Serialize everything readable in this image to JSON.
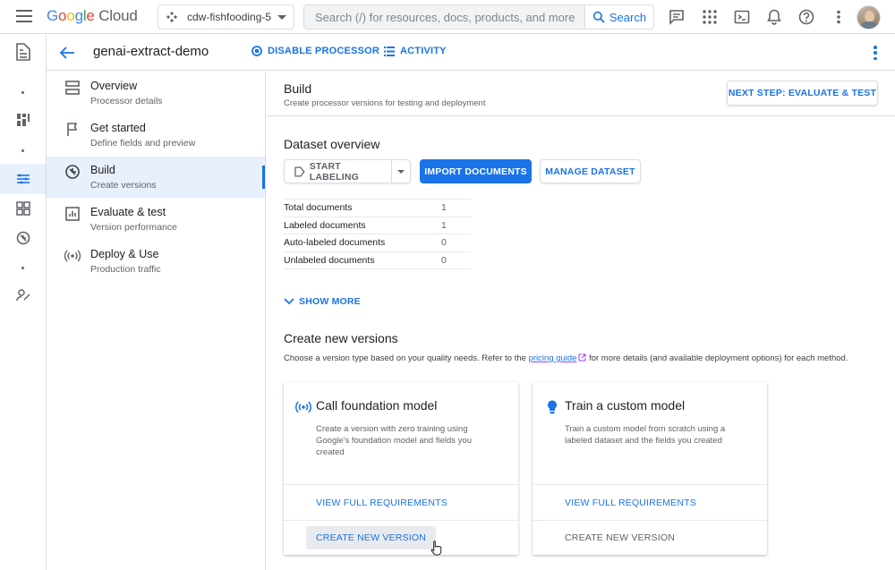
{
  "topbar": {
    "logo_google": [
      "G",
      "o",
      "o",
      "g",
      "l",
      "e"
    ],
    "logo_cloud": "Cloud",
    "project": "cdw-fishfooding-5",
    "search_placeholder": "Search (/) for resources, docs, products, and more",
    "search_button": "Search",
    "icons": [
      "hamburger-icon",
      "project-icon",
      "search-icon",
      "feedback-icon",
      "apps-icon",
      "cloud-shell-icon",
      "notifications-icon",
      "help-icon",
      "more-vert-icon",
      "avatar"
    ]
  },
  "header": {
    "title": "genai-extract-demo",
    "disable_label": "DISABLE PROCESSOR",
    "activity_label": "ACTIVITY"
  },
  "nav": {
    "items": [
      {
        "label": "Overview",
        "sub": "Processor details",
        "icon": "overview-icon"
      },
      {
        "label": "Get started",
        "sub": "Define fields and preview",
        "icon": "flag-icon"
      },
      {
        "label": "Build",
        "sub": "Create versions",
        "icon": "build-icon",
        "active": true
      },
      {
        "label": "Evaluate & test",
        "sub": "Version performance",
        "icon": "chart-icon"
      },
      {
        "label": "Deploy & Use",
        "sub": "Production traffic",
        "icon": "broadcast-icon"
      }
    ]
  },
  "build": {
    "title": "Build",
    "subtitle": "Create processor versions for testing and deployment",
    "next_step": "NEXT STEP: EVALUATE & TEST"
  },
  "dataset": {
    "title": "Dataset overview",
    "start_labeling": "START LABELING",
    "import_documents": "IMPORT DOCUMENTS",
    "manage_dataset": "MANAGE DATASET",
    "rows": [
      {
        "k": "Total documents",
        "v": "1"
      },
      {
        "k": "Labeled documents",
        "v": "1"
      },
      {
        "k": "Auto-labeled documents",
        "v": "0"
      },
      {
        "k": "Unlabeled documents",
        "v": "0"
      }
    ],
    "show_more": "SHOW MORE"
  },
  "versions": {
    "title": "Create new versions",
    "desc_before": "Choose a version type based on your quality needs. Refer to the ",
    "desc_link": "pricing guide",
    "desc_after": " for more details (and available deployment options) for each method.",
    "cards": [
      {
        "title": "Call foundation model",
        "desc": "Create a version with zero training using Google's foundation model and fields you created",
        "link": "VIEW FULL REQUIREMENTS",
        "create": "CREATE NEW VERSION"
      },
      {
        "title": "Train a custom model",
        "desc": "Train a custom model from scratch using a labeled dataset and the fields you created",
        "link": "VIEW FULL REQUIREMENTS",
        "create": "CREATE NEW VERSION"
      }
    ]
  },
  "colors": {
    "accent": "#1a73e8",
    "active_bg": "#e8f0fe",
    "border": "#dadce0"
  }
}
